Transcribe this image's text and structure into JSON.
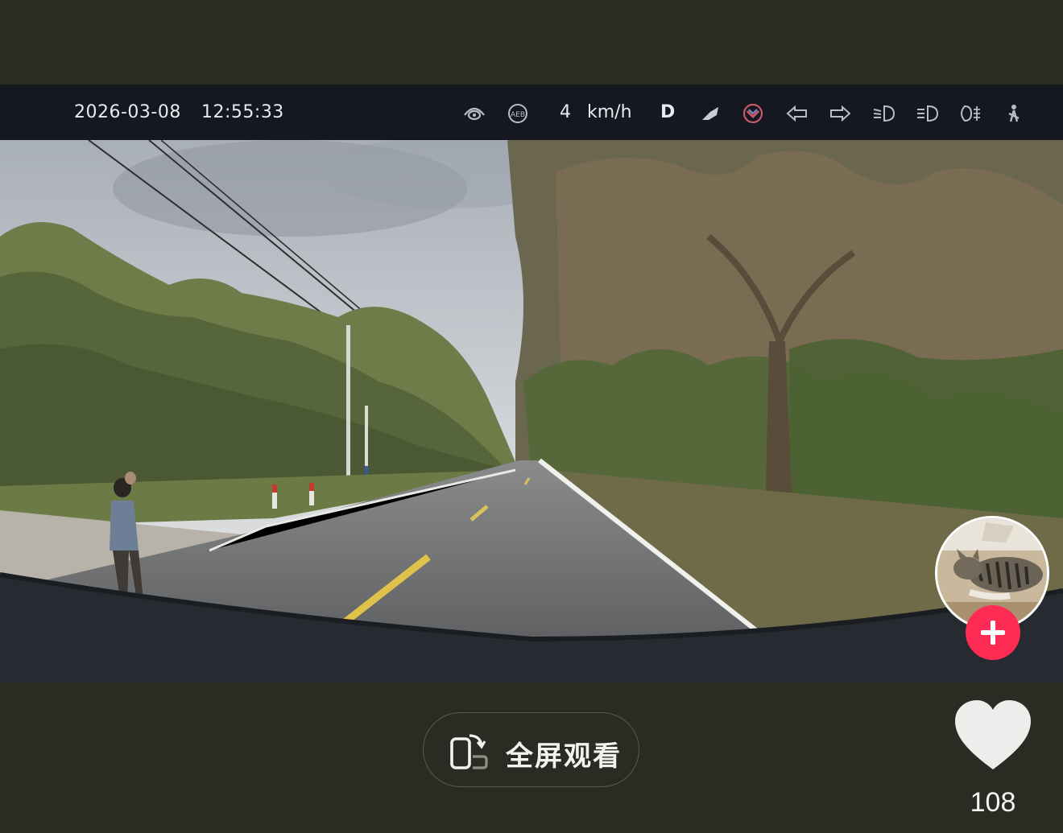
{
  "hud": {
    "date": "2026-03-08",
    "time": "12:55:33",
    "speed": "4",
    "speed_unit": "km/h",
    "gear": "D",
    "icons": [
      "driver-monitor-icon",
      "aeb-icon",
      "lane-assist-icon",
      "safety-shield-icon",
      "left-turn-signal-icon",
      "right-turn-signal-icon",
      "low-beam-icon",
      "high-beam-icon",
      "fog-light-icon",
      "seatbelt-icon"
    ],
    "aeb_text": "AEB"
  },
  "actions": {
    "fullscreen_label": "全屏观看",
    "like_count": "108"
  },
  "colors": {
    "follow_accent": "#fe2c55",
    "page_bg": "#2b2b24",
    "hud_bg": "#151820"
  }
}
